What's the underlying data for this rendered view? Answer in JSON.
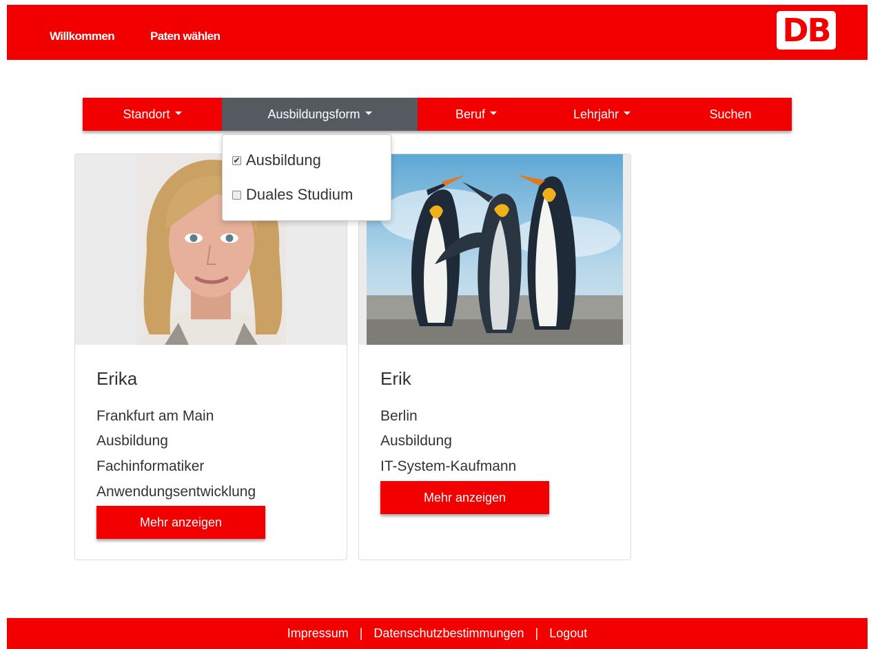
{
  "header": {
    "nav": [
      "Willkommen",
      "Paten wählen"
    ],
    "logo_text": "DB"
  },
  "filters": {
    "items": [
      "Standort",
      "Ausbildungsform",
      "Beruf",
      "Lehrjahr",
      "Suchen"
    ],
    "active": "Ausbildungsform",
    "dropdown": {
      "options": [
        {
          "label": "Ausbildung",
          "checked": true
        },
        {
          "label": "Duales Studium",
          "checked": false
        }
      ]
    }
  },
  "cards": [
    {
      "name": "Erika",
      "lines": [
        "Frankfurt am Main",
        "Ausbildung",
        "Fachinformatiker",
        "Anwendungsentwicklung"
      ],
      "button": "Mehr anzeigen"
    },
    {
      "name": "Erik",
      "lines": [
        "Berlin",
        "Ausbildung",
        "IT-System-Kaufmann"
      ],
      "button": "Mehr anzeigen"
    }
  ],
  "footer": {
    "links": [
      "Impressum",
      "Datenschutzbestimmungen",
      "Logout"
    ],
    "separator": "|"
  },
  "colors": {
    "brand_red": "#f20000",
    "active_filter": "#555a60"
  }
}
